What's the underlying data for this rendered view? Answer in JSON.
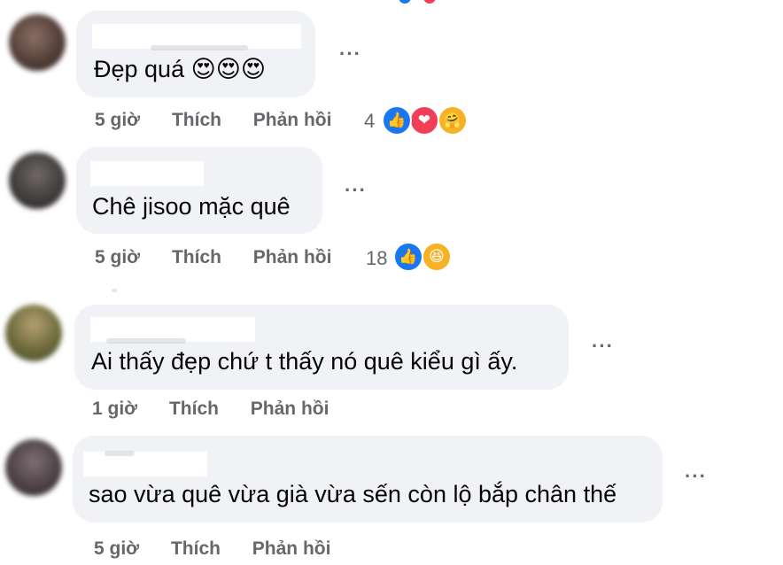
{
  "comments": [
    {
      "text": "Đẹp quá 😍😍😍",
      "time": "5 giờ",
      "like_label": "Thích",
      "reply_label": "Phản hồi",
      "reaction_count": "4",
      "reactions": [
        "like",
        "love",
        "care"
      ]
    },
    {
      "text": "Chê jisoo mặc quê",
      "time": "5 giờ",
      "like_label": "Thích",
      "reply_label": "Phản hồi",
      "reaction_count": "18",
      "reactions": [
        "like",
        "haha"
      ]
    },
    {
      "text": "Ai thấy đẹp chứ t thấy nó quê kiểu gì ấy.",
      "time": "1 giờ",
      "like_label": "Thích",
      "reply_label": "Phản hồi"
    },
    {
      "text": "sao vừa quê vừa già vừa sến còn lộ bắp chân thế",
      "time": "5 giờ",
      "like_label": "Thích",
      "reply_label": "Phản hồi"
    }
  ],
  "more_label": "···",
  "icons": {
    "like": "👍",
    "love": "❤",
    "care": "🤗",
    "haha": "😆"
  },
  "colors": {
    "bubble": "#f0f2f5",
    "meta_text": "#65676b",
    "like_blue": "#1877f2",
    "love_red": "#f33e58",
    "emoji_yellow": "#f7b125"
  }
}
